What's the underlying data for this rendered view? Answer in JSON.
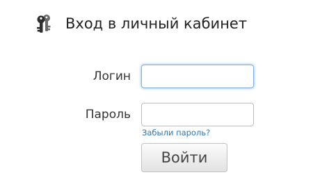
{
  "header": {
    "title": "Вход в личный кабинет",
    "icon": "keys-icon"
  },
  "form": {
    "login_label": "Логин",
    "login_value": "",
    "login_focused": true,
    "password_label": "Пароль",
    "password_value": "",
    "forgot_link": "Забыли пароль?",
    "submit_label": "Войти"
  },
  "colors": {
    "link": "#2a76b8",
    "focus_glow": "#529ade",
    "icon": "#3a3a3a"
  }
}
